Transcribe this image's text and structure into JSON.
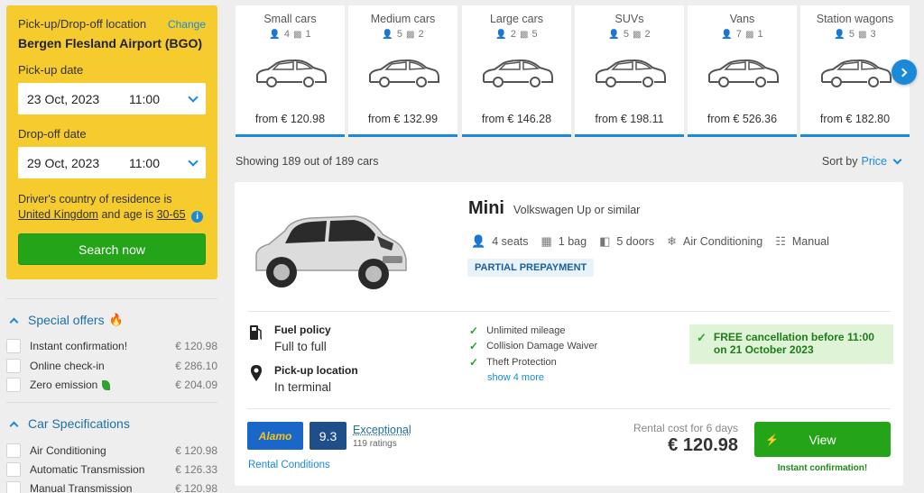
{
  "search": {
    "location_label": "Pick-up/Drop-off location",
    "change_label": "Change",
    "location": "Bergen Flesland Airport (BGO)",
    "pickup_label": "Pick-up date",
    "pickup_date": "23 Oct, 2023",
    "pickup_time": "11:00",
    "dropoff_label": "Drop-off date",
    "dropoff_date": "29 Oct, 2023",
    "dropoff_time": "11:00",
    "country_text_1": "Driver's country of residence is",
    "country": "United Kingdom",
    "age_text": "and age is",
    "age": "30-65",
    "search_button": "Search now"
  },
  "filters": {
    "special_offers": {
      "title": "Special offers",
      "items": [
        {
          "label": "Instant confirmation!",
          "price": "€ 120.98"
        },
        {
          "label": "Online check-in",
          "price": "€ 286.10"
        },
        {
          "label": "Zero emission",
          "price": "€ 204.09"
        }
      ]
    },
    "car_specs": {
      "title": "Car Specifications",
      "items": [
        {
          "label": "Air Conditioning",
          "price": "€ 120.98"
        },
        {
          "label": "Automatic Transmission",
          "price": "€ 126.33"
        },
        {
          "label": "Manual Transmission",
          "price": "€ 120.98"
        }
      ]
    }
  },
  "categories": [
    {
      "name": "Small cars",
      "seats": "4",
      "bags": "1",
      "price": "from € 120.98"
    },
    {
      "name": "Medium cars",
      "seats": "5",
      "bags": "2",
      "price": "from € 132.99"
    },
    {
      "name": "Large cars",
      "seats": "2",
      "bags": "5",
      "price": "from € 146.28"
    },
    {
      "name": "SUVs",
      "seats": "5",
      "bags": "2",
      "price": "from € 198.11"
    },
    {
      "name": "Vans",
      "seats": "7",
      "bags": "1",
      "price": "from € 526.36"
    },
    {
      "name": "Station wagons",
      "seats": "5",
      "bags": "3",
      "price": "from € 182.80"
    }
  ],
  "results_bar": {
    "showing": "Showing 189 out of 189 cars",
    "sort_label": "Sort by",
    "sort_value": "Price"
  },
  "result": {
    "name": "Mini",
    "model": "Volkswagen Up or similar",
    "seats": "4 seats",
    "bags": "1 bag",
    "doors": "5 doors",
    "ac": "Air Conditioning",
    "transmission": "Manual",
    "badge": "PARTIAL PREPAYMENT",
    "fuel_title": "Fuel policy",
    "fuel_value": "Full to full",
    "pickup_title": "Pick-up location",
    "pickup_value": "In terminal",
    "inclusions": [
      "Unlimited mileage",
      "Collision Damage Waiver",
      "Theft Protection"
    ],
    "show_more": "show 4 more",
    "free_cancel": "FREE cancellation before 11:00 on 21 October 2023",
    "supplier": "Alamo",
    "score": "9.3",
    "rating_word": "Exceptional",
    "rating_count": "119 ratings",
    "conditions": "Rental Conditions",
    "rental_label": "Rental cost for 6 days",
    "price": "€ 120.98",
    "view_button": "View",
    "instant": "Instant confirmation!"
  },
  "colors": {
    "accent": "#1a8ad8",
    "panel": "#f5cb2e",
    "cta": "#24a418"
  }
}
